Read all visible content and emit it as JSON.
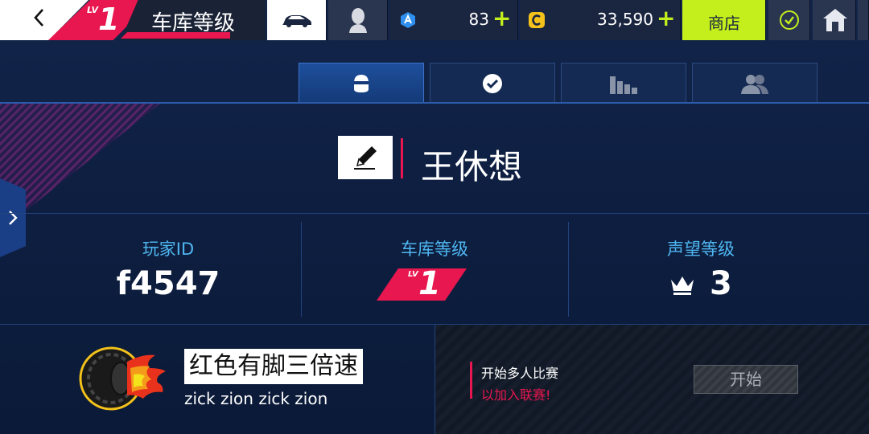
{
  "topbar": {
    "back_icon": "back-arrow-icon",
    "level_prefix": "LV",
    "level_value": "1",
    "title": "车库等级",
    "token_amount": "83",
    "coin_amount": "33,590",
    "plus_symbol": "+",
    "shop_label": "商店"
  },
  "tabs": [
    {
      "name": "profile",
      "icon": "helmet-icon",
      "active": true
    },
    {
      "name": "achievements",
      "icon": "checkmark-icon",
      "active": false
    },
    {
      "name": "stats",
      "icon": "bar-chart-icon",
      "active": false
    },
    {
      "name": "friends",
      "icon": "people-icon",
      "active": false
    }
  ],
  "profile": {
    "player_name": "王休想"
  },
  "stats": {
    "player_id_label": "玩家ID",
    "player_id_value": "f4547",
    "garage_level_label": "车库等级",
    "garage_level_prefix": "LV",
    "garage_level_value": "1",
    "prestige_label": "声望等级",
    "prestige_value": "3"
  },
  "team": {
    "name": "红色有脚三倍速",
    "tag": "zick zion zick zion"
  },
  "multiplayer": {
    "title": "开始多人比赛",
    "subtitle": "以加入联赛!",
    "start_label": "开始"
  },
  "colors": {
    "accent_pink": "#e8174f",
    "accent_lime": "#c4ef1c",
    "label_blue": "#4fb6f0",
    "bg_navy": "#0c1a36"
  }
}
